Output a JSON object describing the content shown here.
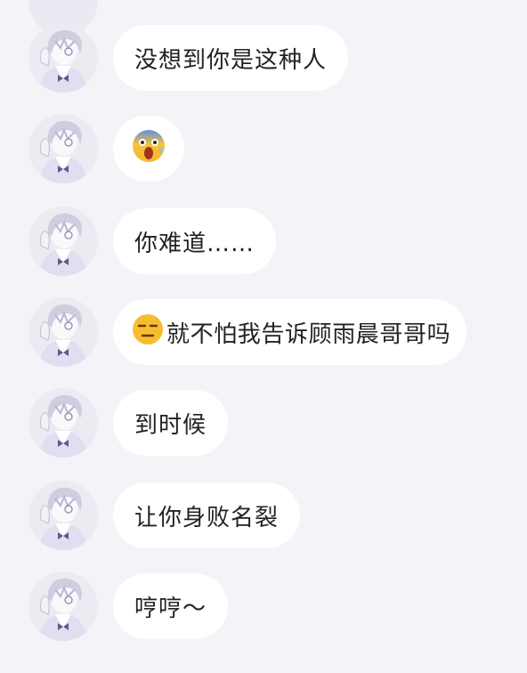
{
  "messages": [
    {
      "text": "没想到你是这种人",
      "emoji": null
    },
    {
      "text": "",
      "emoji": "screaming-face"
    },
    {
      "text": "你难道……",
      "emoji": null
    },
    {
      "text": "就不怕我告诉顾雨晨哥哥吗",
      "emoji": "unamused-face"
    },
    {
      "text": "到时候",
      "emoji": null
    },
    {
      "text": "让你身败名裂",
      "emoji": null
    },
    {
      "text": "哼哼～",
      "emoji": null
    }
  ],
  "colors": {
    "background": "#f3f4f7",
    "bubble": "#ffffff",
    "text": "#222222",
    "avatar_accent": "#6f6a9c"
  }
}
